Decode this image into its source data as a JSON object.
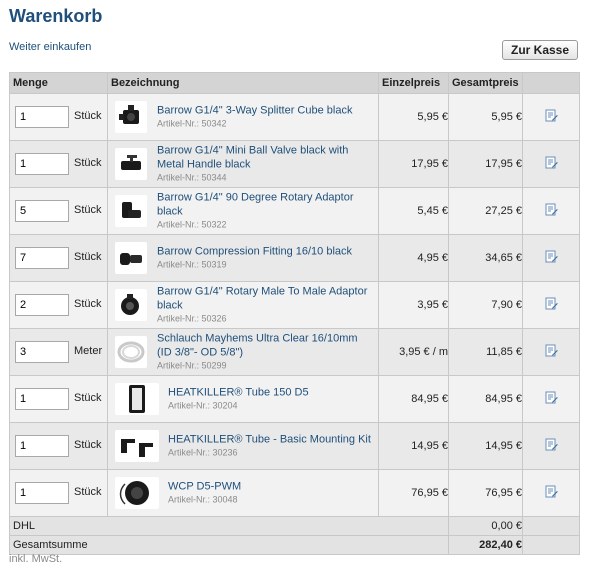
{
  "page": {
    "title": "Warenkorb",
    "continue_link": "Weiter einkaufen",
    "checkout_button": "Zur Kasse"
  },
  "table": {
    "headers": {
      "qty": "Menge",
      "description": "Bezeichnung",
      "unit_price": "Einzelpreis",
      "total_price": "Gesamtpreis"
    },
    "items": [
      {
        "qty": "1",
        "unit": "Stück",
        "name": "Barrow G1/4\" 3-Way Splitter Cube black",
        "article": "Artikel-Nr.: 50342",
        "unit_price": "5,95 €",
        "total": "5,95 €",
        "icon": "splitter-cube-thumb"
      },
      {
        "qty": "1",
        "unit": "Stück",
        "name": "Barrow G1/4\" Mini Ball Valve black with Metal Handle black",
        "article": "Artikel-Nr.: 50344",
        "unit_price": "17,95 €",
        "total": "17,95 €",
        "icon": "ball-valve-thumb"
      },
      {
        "qty": "5",
        "unit": "Stück",
        "name": "Barrow G1/4\" 90 Degree Rotary Adaptor black",
        "article": "Artikel-Nr.: 50322",
        "unit_price": "5,45 €",
        "total": "27,25 €",
        "icon": "rotary-adaptor-thumb"
      },
      {
        "qty": "7",
        "unit": "Stück",
        "name": "Barrow Compression Fitting 16/10 black",
        "article": "Artikel-Nr.: 50319",
        "unit_price": "4,95 €",
        "total": "34,65 €",
        "icon": "compression-fitting-thumb"
      },
      {
        "qty": "2",
        "unit": "Stück",
        "name": "Barrow G1/4\" Rotary Male To Male Adaptor black",
        "article": "Artikel-Nr.: 50326",
        "unit_price": "3,95 €",
        "total": "7,90 €",
        "icon": "male-adaptor-thumb"
      },
      {
        "qty": "3",
        "unit": "Meter",
        "name": "Schlauch Mayhems Ultra Clear 16/10mm (ID 3/8\"- OD 5/8\")",
        "article": "Artikel-Nr.: 50299",
        "unit_price": "3,95 € / m",
        "total": "11,85 €",
        "icon": "tube-coil-thumb"
      },
      {
        "qty": "1",
        "unit": "Stück",
        "name": "HEATKILLER® Tube 150 D5",
        "article": "Artikel-Nr.: 30204",
        "unit_price": "84,95 €",
        "total": "84,95 €",
        "icon": "reservoir-tube-thumb"
      },
      {
        "qty": "1",
        "unit": "Stück",
        "name": "HEATKILLER® Tube - Basic Mounting Kit",
        "article": "Artikel-Nr.: 30236",
        "unit_price": "14,95 €",
        "total": "14,95 €",
        "icon": "mounting-kit-thumb"
      },
      {
        "qty": "1",
        "unit": "Stück",
        "name": "WCP D5-PWM",
        "article": "Artikel-Nr.: 30048",
        "unit_price": "76,95 €",
        "total": "76,95 €",
        "icon": "pump-thumb"
      }
    ],
    "shipping": {
      "label": "DHL",
      "value": "0,00 €"
    },
    "sum": {
      "label": "Gesamtsumme",
      "value": "282,40 €"
    }
  },
  "note": "inkl. MwSt.",
  "colors": {
    "title": "#1f4f7a",
    "link": "#1f4f7a",
    "header_bg": "#d4d4d4"
  }
}
